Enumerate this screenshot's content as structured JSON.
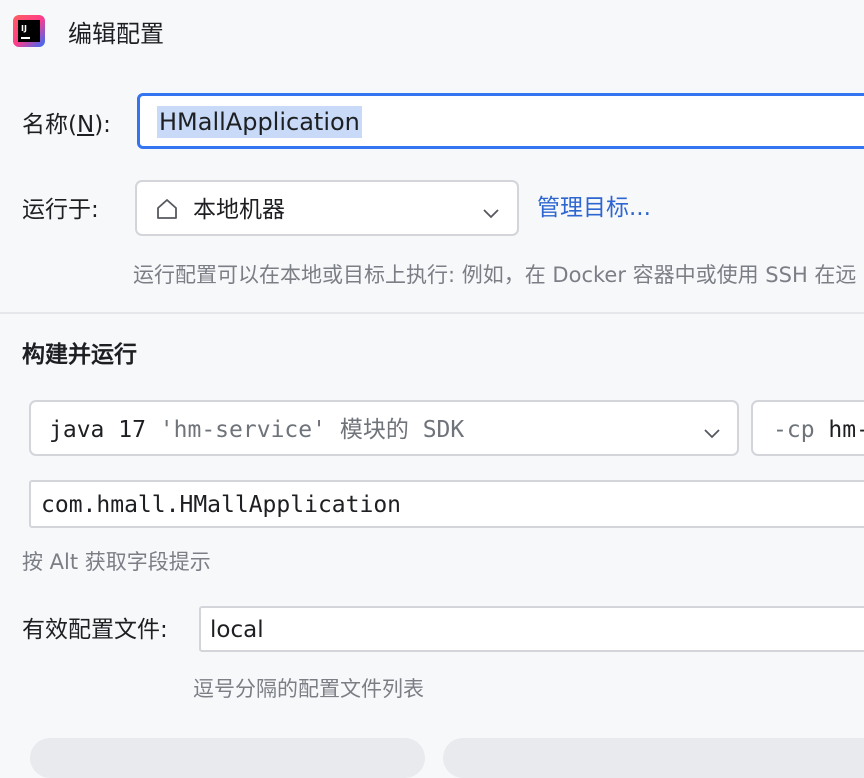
{
  "window": {
    "title": "编辑配置"
  },
  "name": {
    "label_prefix": "名称(",
    "label_mnemonic": "N",
    "label_suffix": "):",
    "value": "HMallApplication"
  },
  "run_on": {
    "label": "运行于:",
    "selected": "本地机器",
    "manage_link": "管理目标...",
    "hint": "运行配置可以在本地或目标上执行: 例如，在 Docker 容器中或使用 SSH 在远"
  },
  "build_run": {
    "section_title": "构建并运行",
    "sdk": {
      "java": "java 17",
      "module": "'hm-service'",
      "suffix": "模块的",
      "sdk": "SDK"
    },
    "classpath": {
      "flag": "-cp",
      "value": "hm-"
    },
    "main_class": "com.hmall.HMallApplication",
    "field_hint": "按 Alt 获取字段提示"
  },
  "profiles": {
    "label": "有效配置文件:",
    "value": "local",
    "hint": "逗号分隔的配置文件列表"
  },
  "colors": {
    "accent": "#3574f0",
    "link": "#2e66d1",
    "selection": "#c8daf8"
  }
}
